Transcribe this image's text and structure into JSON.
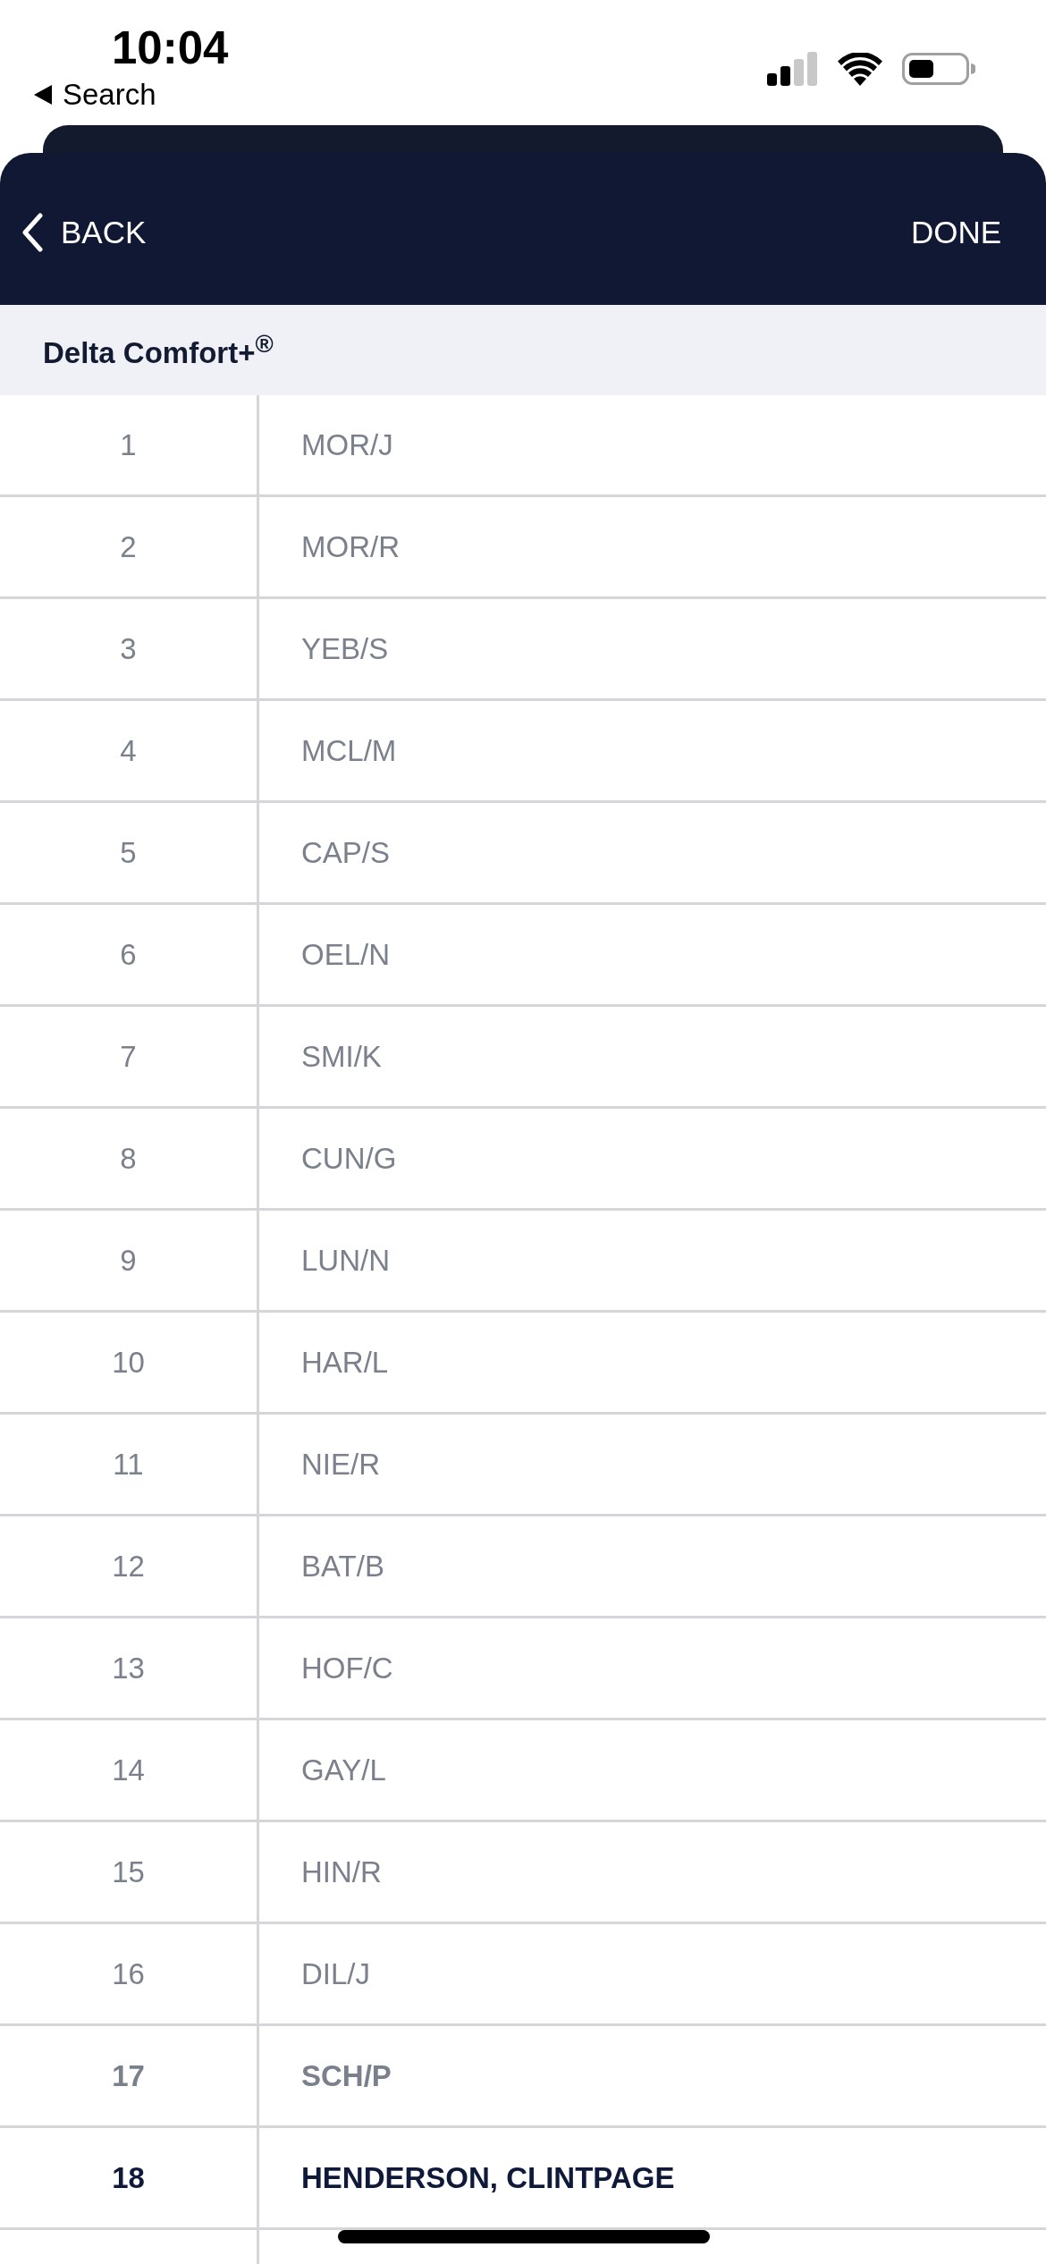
{
  "status_bar": {
    "time": "10:04",
    "back_link": "Search"
  },
  "nav_bar": {
    "back_button": "BACK",
    "done_button": "DONE"
  },
  "section": {
    "title": "Delta Comfort+$^{®}$"
  },
  "table": {
    "rows": [
      {
        "number": "1",
        "name": "MOR/J",
        "kind": "normal"
      },
      {
        "number": "2",
        "name": "MOR/R",
        "kind": "normal"
      },
      {
        "number": "3",
        "name": "YEB/S",
        "kind": "normal"
      },
      {
        "number": "4",
        "name": "MCL/M",
        "kind": "normal"
      },
      {
        "number": "5",
        "name": "CAP/S",
        "kind": "normal"
      },
      {
        "number": "6",
        "name": "OEL/N",
        "kind": "normal"
      },
      {
        "number": "7",
        "name": "SMI/K",
        "kind": "normal"
      },
      {
        "number": "8",
        "name": "CUN/G",
        "kind": "normal"
      },
      {
        "number": "9",
        "name": "LUN/N",
        "kind": "normal"
      },
      {
        "number": "10",
        "name": "HAR/L",
        "kind": "normal"
      },
      {
        "number": "11",
        "name": "NIE/R",
        "kind": "normal"
      },
      {
        "number": "12",
        "name": "BAT/B",
        "kind": "normal"
      },
      {
        "number": "13",
        "name": "HOF/C",
        "kind": "normal"
      },
      {
        "number": "14",
        "name": "GAY/L",
        "kind": "normal"
      },
      {
        "number": "15",
        "name": "HIN/R",
        "kind": "normal"
      },
      {
        "number": "16",
        "name": "DIL/J",
        "kind": "normal"
      },
      {
        "number": "17",
        "name": "SCH/P",
        "kind": "emphasized"
      },
      {
        "number": "18",
        "name": "HENDERSON, CLINTPAGE",
        "kind": "current"
      }
    ]
  }
}
